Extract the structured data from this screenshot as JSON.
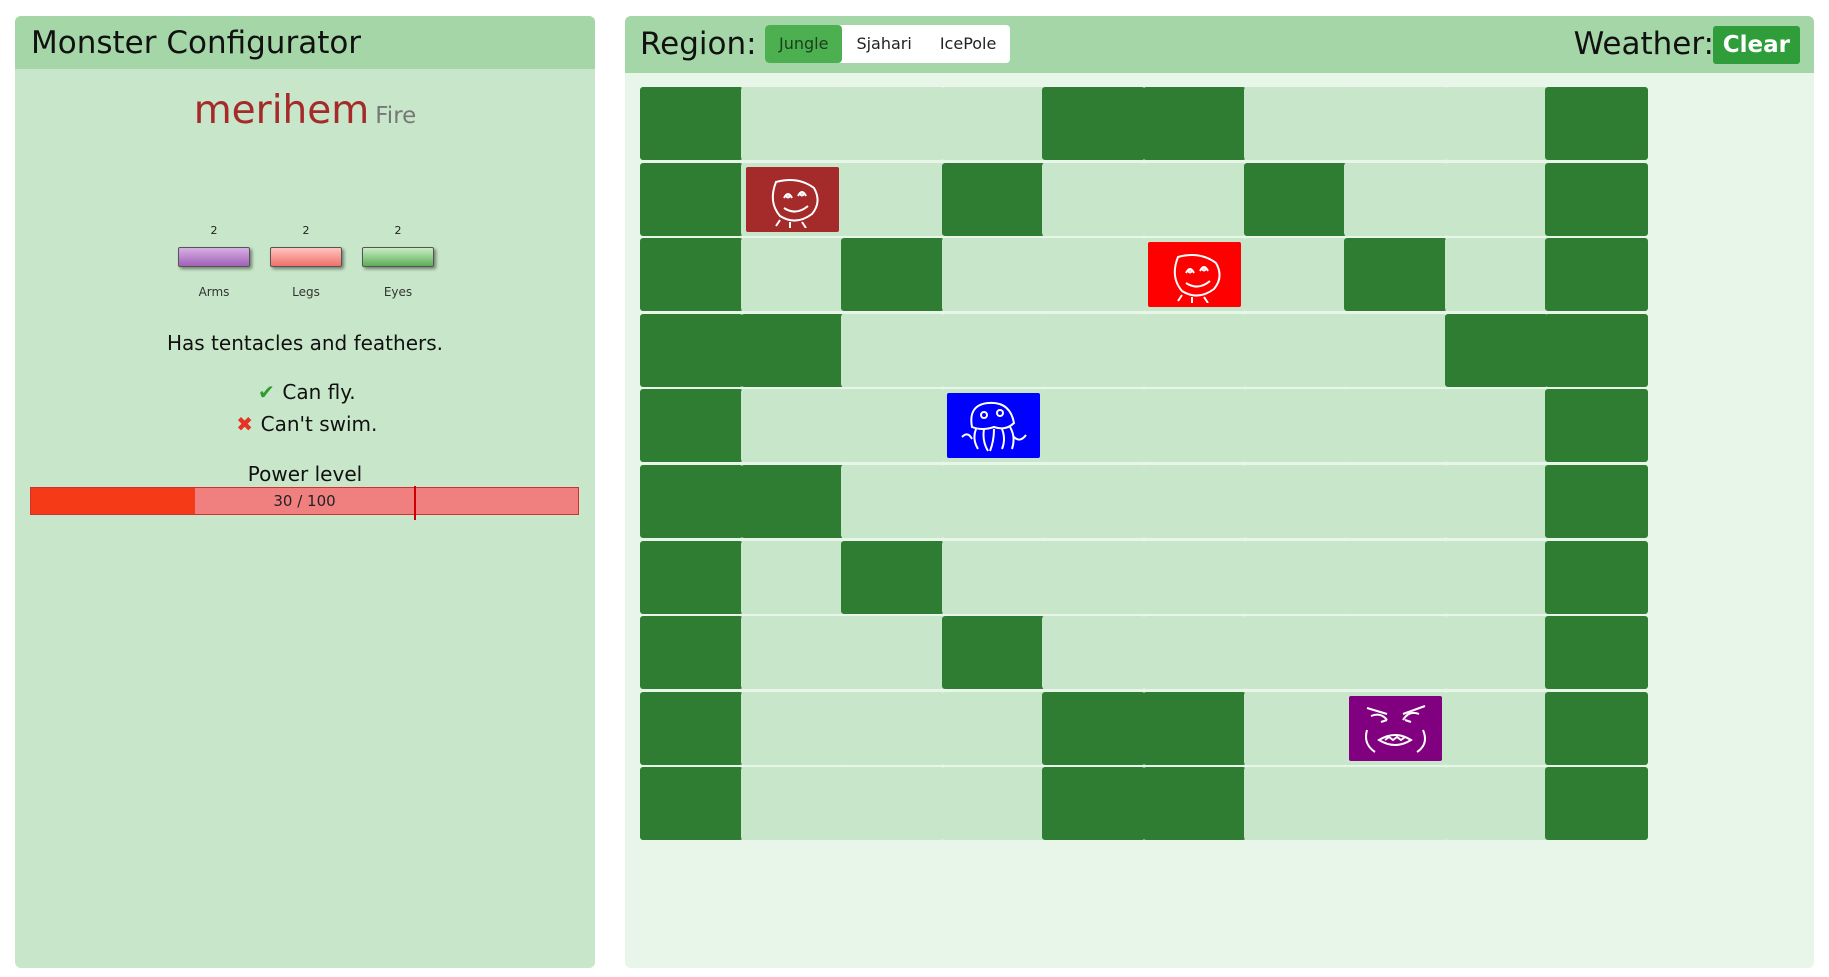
{
  "left": {
    "title": "Monster Configurator",
    "monster": {
      "name": "merihem",
      "type": "Fire"
    },
    "stats": [
      {
        "label": "Arms",
        "count": "2"
      },
      {
        "label": "Legs",
        "count": "2"
      },
      {
        "label": "Eyes",
        "count": "2"
      }
    ],
    "description": "Has tentacles and feathers.",
    "abilities": {
      "fly": {
        "text": "Can fly.",
        "icon": "check-icon",
        "ok": true
      },
      "swim": {
        "text": "Can't swim.",
        "icon": "cross-icon",
        "ok": false
      }
    },
    "power": {
      "label": "Power level",
      "text": "30 / 100",
      "value": 30,
      "max": 100,
      "threshold_fraction": 0.7
    }
  },
  "right": {
    "region_label": "Region:",
    "regions": [
      "Jungle",
      "Sjahari",
      "IcePole"
    ],
    "active_region": "Jungle",
    "weather_label": "Weather:",
    "weather": "Clear"
  },
  "colors": {
    "wall": "#2e7d32",
    "empty": "#c8e6c9",
    "header": "#a5d6a7",
    "accent": "#4caf50",
    "monster_red_dark": "#a52a2a",
    "monster_red": "#ff0000",
    "monster_blue": "#0000ff",
    "monster_purple": "#800080"
  },
  "board": {
    "rows": [
      "WEEEWWEEEW",
      "WAEWEEWEEW",
      "WEWEEBEWEW",
      "WWEEEEEEWW",
      "WEECEEEEEW",
      "WWEEEEEEEW",
      "WEWEEEEEEW",
      "WEEWEEEEEW",
      "WEEEWWEDEW",
      "WEEEWWEEEW"
    ],
    "legend": {
      "W": "wall",
      "E": "empty",
      "A": "monster",
      "B": "monster",
      "C": "monster",
      "D": "monster"
    },
    "monsters": {
      "A": {
        "color": "#a52a2a",
        "icon": "monster-face-icon"
      },
      "B": {
        "color": "#ff0000",
        "icon": "monster-face-icon"
      },
      "C": {
        "color": "#0000ff",
        "icon": "monster-jellyfish-icon"
      },
      "D": {
        "color": "#800080",
        "icon": "monster-angry-icon"
      }
    }
  }
}
